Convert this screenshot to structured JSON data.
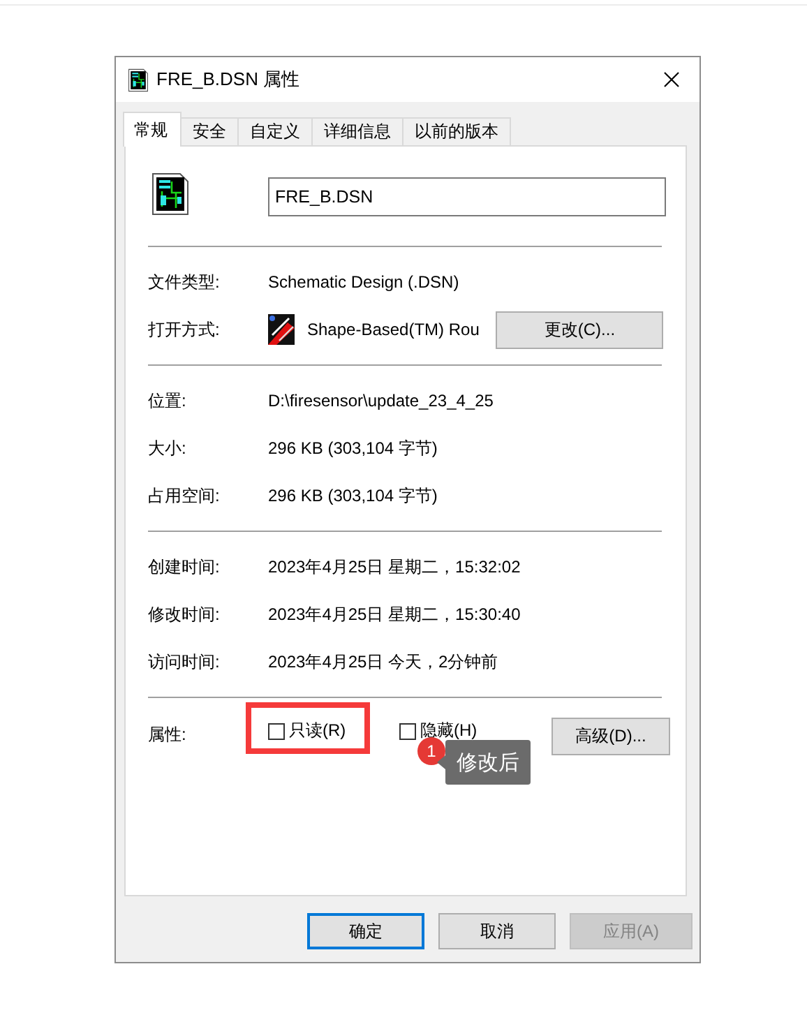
{
  "window": {
    "title": "FRE_B.DSN 属性"
  },
  "tabs": [
    {
      "label": "常规",
      "selected": true
    },
    {
      "label": "安全",
      "selected": false
    },
    {
      "label": "自定义",
      "selected": false
    },
    {
      "label": "详细信息",
      "selected": false
    },
    {
      "label": "以前的版本",
      "selected": false
    }
  ],
  "file_name": {
    "value": "FRE_B.DSN"
  },
  "sections": [
    {
      "rows": [
        {
          "label": "文件类型:",
          "value": "Schematic Design (.DSN)",
          "kind": "text"
        },
        {
          "label": "打开方式:",
          "value": "Shape-Based(TM) Rou",
          "kind": "app",
          "button": "更改(C)..."
        }
      ]
    },
    {
      "rows": [
        {
          "label": "位置:",
          "value": "D:\\firesensor\\update_23_4_25",
          "kind": "text"
        },
        {
          "label": "大小:",
          "value": "296 KB (303,104 字节)",
          "kind": "text"
        },
        {
          "label": "占用空间:",
          "value": "296 KB (303,104 字节)",
          "kind": "text"
        }
      ]
    },
    {
      "rows": [
        {
          "label": "创建时间:",
          "value": "2023年4月25日 星期二，15:32:02",
          "kind": "text"
        },
        {
          "label": "修改时间:",
          "value": "2023年4月25日 星期二，15:30:40",
          "kind": "text"
        },
        {
          "label": "访问时间:",
          "value": "2023年4月25日 今天，2分钟前",
          "kind": "text"
        }
      ]
    }
  ],
  "attributes": {
    "label": "属性:",
    "checkboxes": [
      {
        "label": "只读(R)",
        "checked": false,
        "highlighted": true
      },
      {
        "label": "隐藏(H)",
        "checked": false,
        "highlighted": false
      }
    ],
    "button": "高级(D)..."
  },
  "annotation": {
    "badge": "1",
    "tooltip": "修改后"
  },
  "buttons": [
    {
      "label": "确定",
      "kind": "default"
    },
    {
      "label": "取消",
      "kind": "normal"
    },
    {
      "label": "应用(A)",
      "kind": "disabled"
    }
  ]
}
